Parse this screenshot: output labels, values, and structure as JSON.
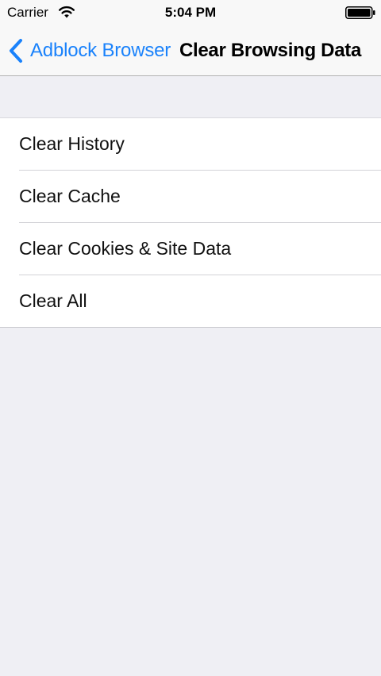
{
  "status_bar": {
    "carrier": "Carrier",
    "time": "5:04 PM",
    "wifi_icon": "wifi-icon",
    "battery_icon": "battery-icon"
  },
  "nav": {
    "back_label": "Adblock Browser",
    "back_icon": "chevron-left-icon",
    "title": "Clear Browsing Data"
  },
  "list": {
    "items": [
      {
        "label": "Clear History"
      },
      {
        "label": "Clear Cache"
      },
      {
        "label": "Clear Cookies & Site Data"
      },
      {
        "label": "Clear All"
      }
    ]
  },
  "colors": {
    "accent": "#1a82fb",
    "background": "#efeff4"
  }
}
